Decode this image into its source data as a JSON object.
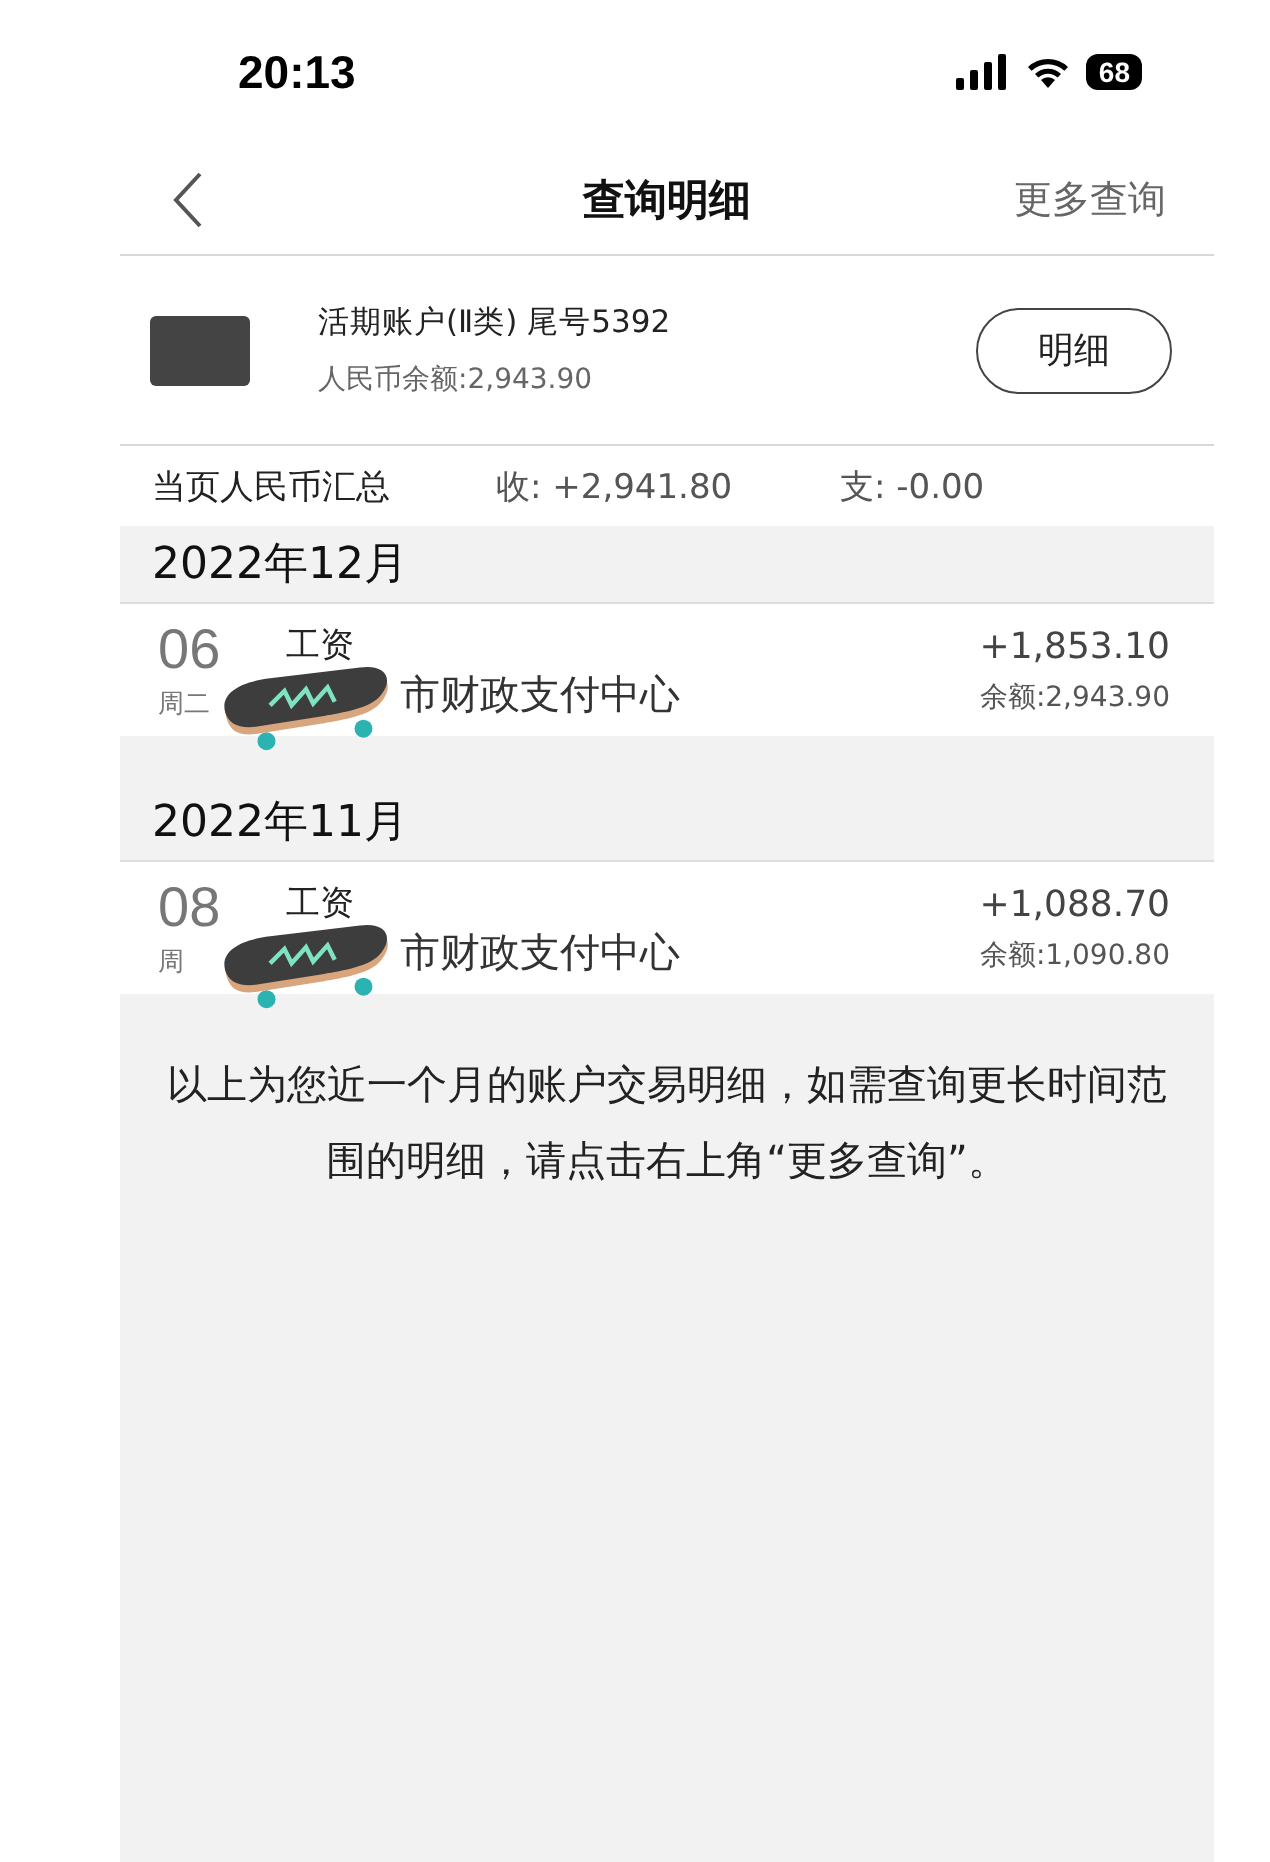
{
  "status_bar": {
    "time": "20:13",
    "battery": "68"
  },
  "nav": {
    "title": "查询明细",
    "action": "更多查询"
  },
  "account": {
    "name": "活期账户(Ⅱ类) 尾号5392",
    "balance": "人民币余额:2,943.90",
    "button": "明细"
  },
  "summary": {
    "label": "当页人民币汇总",
    "income": "收: +2,941.80",
    "expense": "支: -0.00"
  },
  "months": [
    {
      "title": "2022年12月",
      "transactions": [
        {
          "day": "06",
          "weekday": "周二",
          "type": "工资",
          "payer": "市财政支付中心",
          "amount": "+1,853.10",
          "balance": "余额:2,943.90"
        }
      ]
    },
    {
      "title": "2022年11月",
      "transactions": [
        {
          "day": "08",
          "weekday": "周",
          "type": "工资",
          "payer": "市财政支付中心",
          "amount": "+1,088.70",
          "balance": "余额:1,090.80"
        }
      ]
    }
  ],
  "note": "以上为您近一个月的账户交易明细，如需查询更长时间范围的明细，请点击右上角“更多查询”。"
}
